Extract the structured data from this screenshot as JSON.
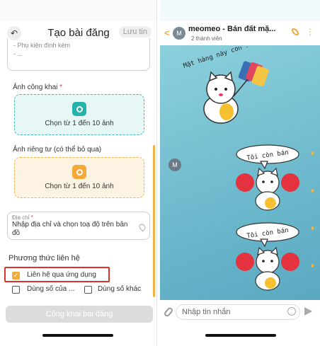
{
  "left": {
    "header": {
      "title": "Tạo bài đăng",
      "save_label": "Lưu tin"
    },
    "textarea": {
      "line1": "- Phụ kiện đính kèm",
      "line2": "- ..."
    },
    "public_photos": {
      "label": "Ảnh công khai",
      "required": "*",
      "button_text": "Chọn từ 1 đến 10 ảnh"
    },
    "private_photos": {
      "label": "Ảnh riêng tư (có thể bỏ qua)",
      "button_text": "Chọn từ 1 đến 10 ảnh"
    },
    "address": {
      "label": "Địa chỉ",
      "required": "*",
      "value": "Nhập địa chỉ và chọn toạ độ trên bản đồ"
    },
    "contact": {
      "title": "Phương thức liên hệ",
      "opt_app": "Liên hệ qua ứng dụng",
      "opt_own": "Dùng số của ...",
      "opt_other": "Dùng số khác",
      "checked": [
        "opt_app"
      ]
    },
    "publish_label": "Công khai bài đăng",
    "colors": {
      "accent_orange": "#f4a93a",
      "accent_teal": "#22b3aa",
      "highlight_red": "#d9342b"
    }
  },
  "right": {
    "header": {
      "avatar_letter": "M",
      "title": "meomeo - Bán đất mặ...",
      "members": "2 thành viên"
    },
    "sender_avatar_letter": "M",
    "sticker1_text": "Mặt hàng này còn không?",
    "sticker2_text": "Tôi còn bán",
    "sticker3_text": "Tôi còn bán",
    "input_placeholder": "Nhập tin nhắn",
    "icons": [
      "back-icon",
      "phone-icon",
      "more-icon",
      "attach-icon",
      "emoji-icon",
      "send-icon"
    ]
  }
}
